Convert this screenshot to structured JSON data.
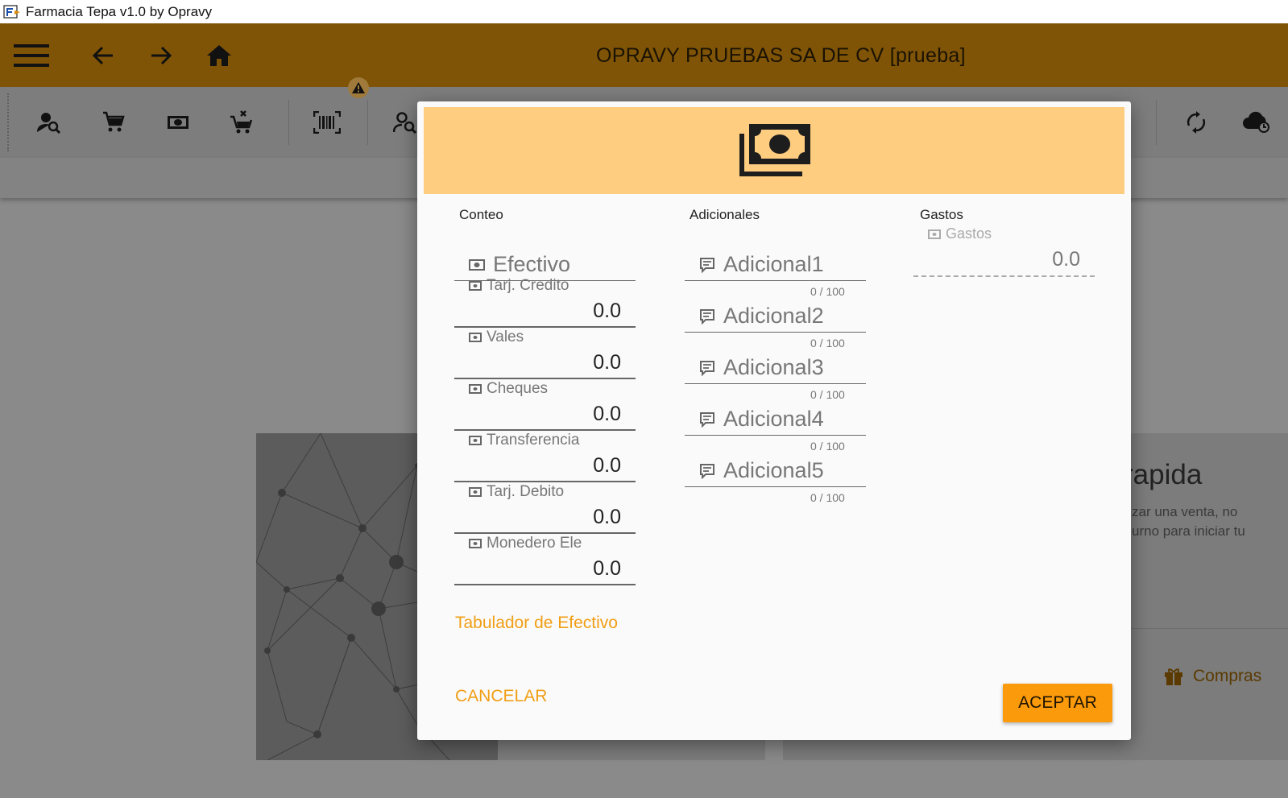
{
  "window": {
    "title": "Farmacia Tepa v1.0 by Opravy"
  },
  "header": {
    "company": "OPRAVY PRUEBAS SA DE CV [prueba]"
  },
  "background": {
    "card_title": "rapida",
    "card_desc_line1": "zar una venta, no",
    "card_desc_line2": "urno para iniciar tu",
    "compras_label": "Compras"
  },
  "dialog": {
    "columns": {
      "conteo": "Conteo",
      "adicionales": "Adicionales",
      "gastos": "Gastos"
    },
    "conteo": {
      "efectivo_label": "Efectivo",
      "fields": [
        {
          "label": "Tarj. Credito",
          "value": "0.0"
        },
        {
          "label": "Vales",
          "value": "0.0"
        },
        {
          "label": "Cheques",
          "value": "0.0"
        },
        {
          "label": "Transferencia",
          "value": "0.0"
        },
        {
          "label": "Tarj. Debito",
          "value": "0.0"
        },
        {
          "label": "Monedero Ele",
          "value": "0.0"
        }
      ]
    },
    "adicionales": [
      {
        "label": "Adicional1",
        "counter": "0 / 100"
      },
      {
        "label": "Adicional2",
        "counter": "0 / 100"
      },
      {
        "label": "Adicional3",
        "counter": "0 / 100"
      },
      {
        "label": "Adicional4",
        "counter": "0 / 100"
      },
      {
        "label": "Adicional5",
        "counter": "0 / 100"
      }
    ],
    "gastos": {
      "label": "Gastos",
      "value": "0.0"
    },
    "tabulador_link": "Tabulador de Efectivo",
    "cancel_label": "CANCELAR",
    "accept_label": "ACEPTAR"
  },
  "colors": {
    "appbar": "#7f5406",
    "dialog_header": "#ffcd80",
    "accent": "#f19e15",
    "accept_button": "#fb9a0b"
  },
  "icons": {
    "toolbar": [
      "search-client-icon",
      "cart-icon",
      "cash-icon",
      "cart-remove-icon",
      "barcode-icon",
      "search-client-icon",
      "sync-icon",
      "cloud-sync-icon"
    ],
    "header": [
      "menu-icon",
      "back-arrow-icon",
      "forward-arrow-icon",
      "home-icon"
    ],
    "dialog": "cash-multiple-icon"
  }
}
